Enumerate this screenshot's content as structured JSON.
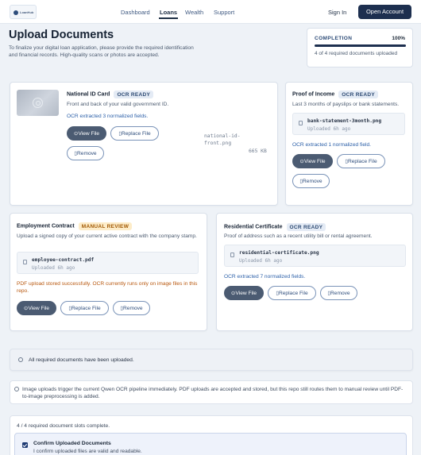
{
  "nav": {
    "logo_text": "LoanHub",
    "links": [
      "Dashboard",
      "Loans",
      "Wealth",
      "Support"
    ],
    "active": "Loans",
    "sign_in": "Sign In",
    "open_account": "Open Account"
  },
  "header": {
    "title": "Upload Documents",
    "subtitle": "To finalize your digital loan application, please provide the required identification and financial records. High-quality scans or photos are accepted."
  },
  "completion": {
    "label": "COMPLETION",
    "percent": "100%",
    "progress": 1.0,
    "status": "4 of 4 required documents uploaded"
  },
  "buttons": {
    "view": "⊙View File",
    "replace": "▯Replace File",
    "remove": "▯Remove"
  },
  "documents": {
    "national_id": {
      "title": "National ID Card",
      "badge": "OCR READY",
      "desc": "Front and back of your valid government ID.",
      "ocr": "OCR extracted 3 normalized fields.",
      "file_name": "national-id-front.png",
      "file_name_l1": "national-id-",
      "file_name_l2": "front.png",
      "file_size": "665 KB"
    },
    "proof_income": {
      "title": "Proof of Income",
      "badge": "OCR READY",
      "desc": "Last 3 months of payslips or bank statements.",
      "file_name": "bank-statement-3month.png",
      "file_age": "Uploaded 6h ago",
      "ocr": "OCR extracted 1 normalized field."
    },
    "employment": {
      "title": "Employment Contract",
      "badge": "MANUAL REVIEW",
      "desc": "Upload a signed copy of your current active contract with the company stamp.",
      "file_name": "employee-contract.pdf",
      "file_age": "Uploaded 6h ago",
      "warning": "PDF upload stored successfully. OCR currently runs only on image files in this repo."
    },
    "residential": {
      "title": "Residential Certificate",
      "badge": "OCR READY",
      "desc": "Proof of address such as a recent utility bill or rental agreement.",
      "file_name": "residential-certificate.png",
      "file_age": "Uploaded 6h ago",
      "ocr": "OCR extracted 7 normalized fields."
    }
  },
  "notice": "All required documents have been uploaded.",
  "help": "Image uploads trigger the current Qwen OCR pipeline immediately. PDF uploads are accepted and stored, but this repo still routes them to manual review until PDF-to-image preprocessing is added.",
  "summary": {
    "slots": "4 / 4 required document slots complete.",
    "confirm_title": "Confirm Uploaded Documents",
    "confirm_desc": "I confirm uploaded files are valid and readable."
  }
}
